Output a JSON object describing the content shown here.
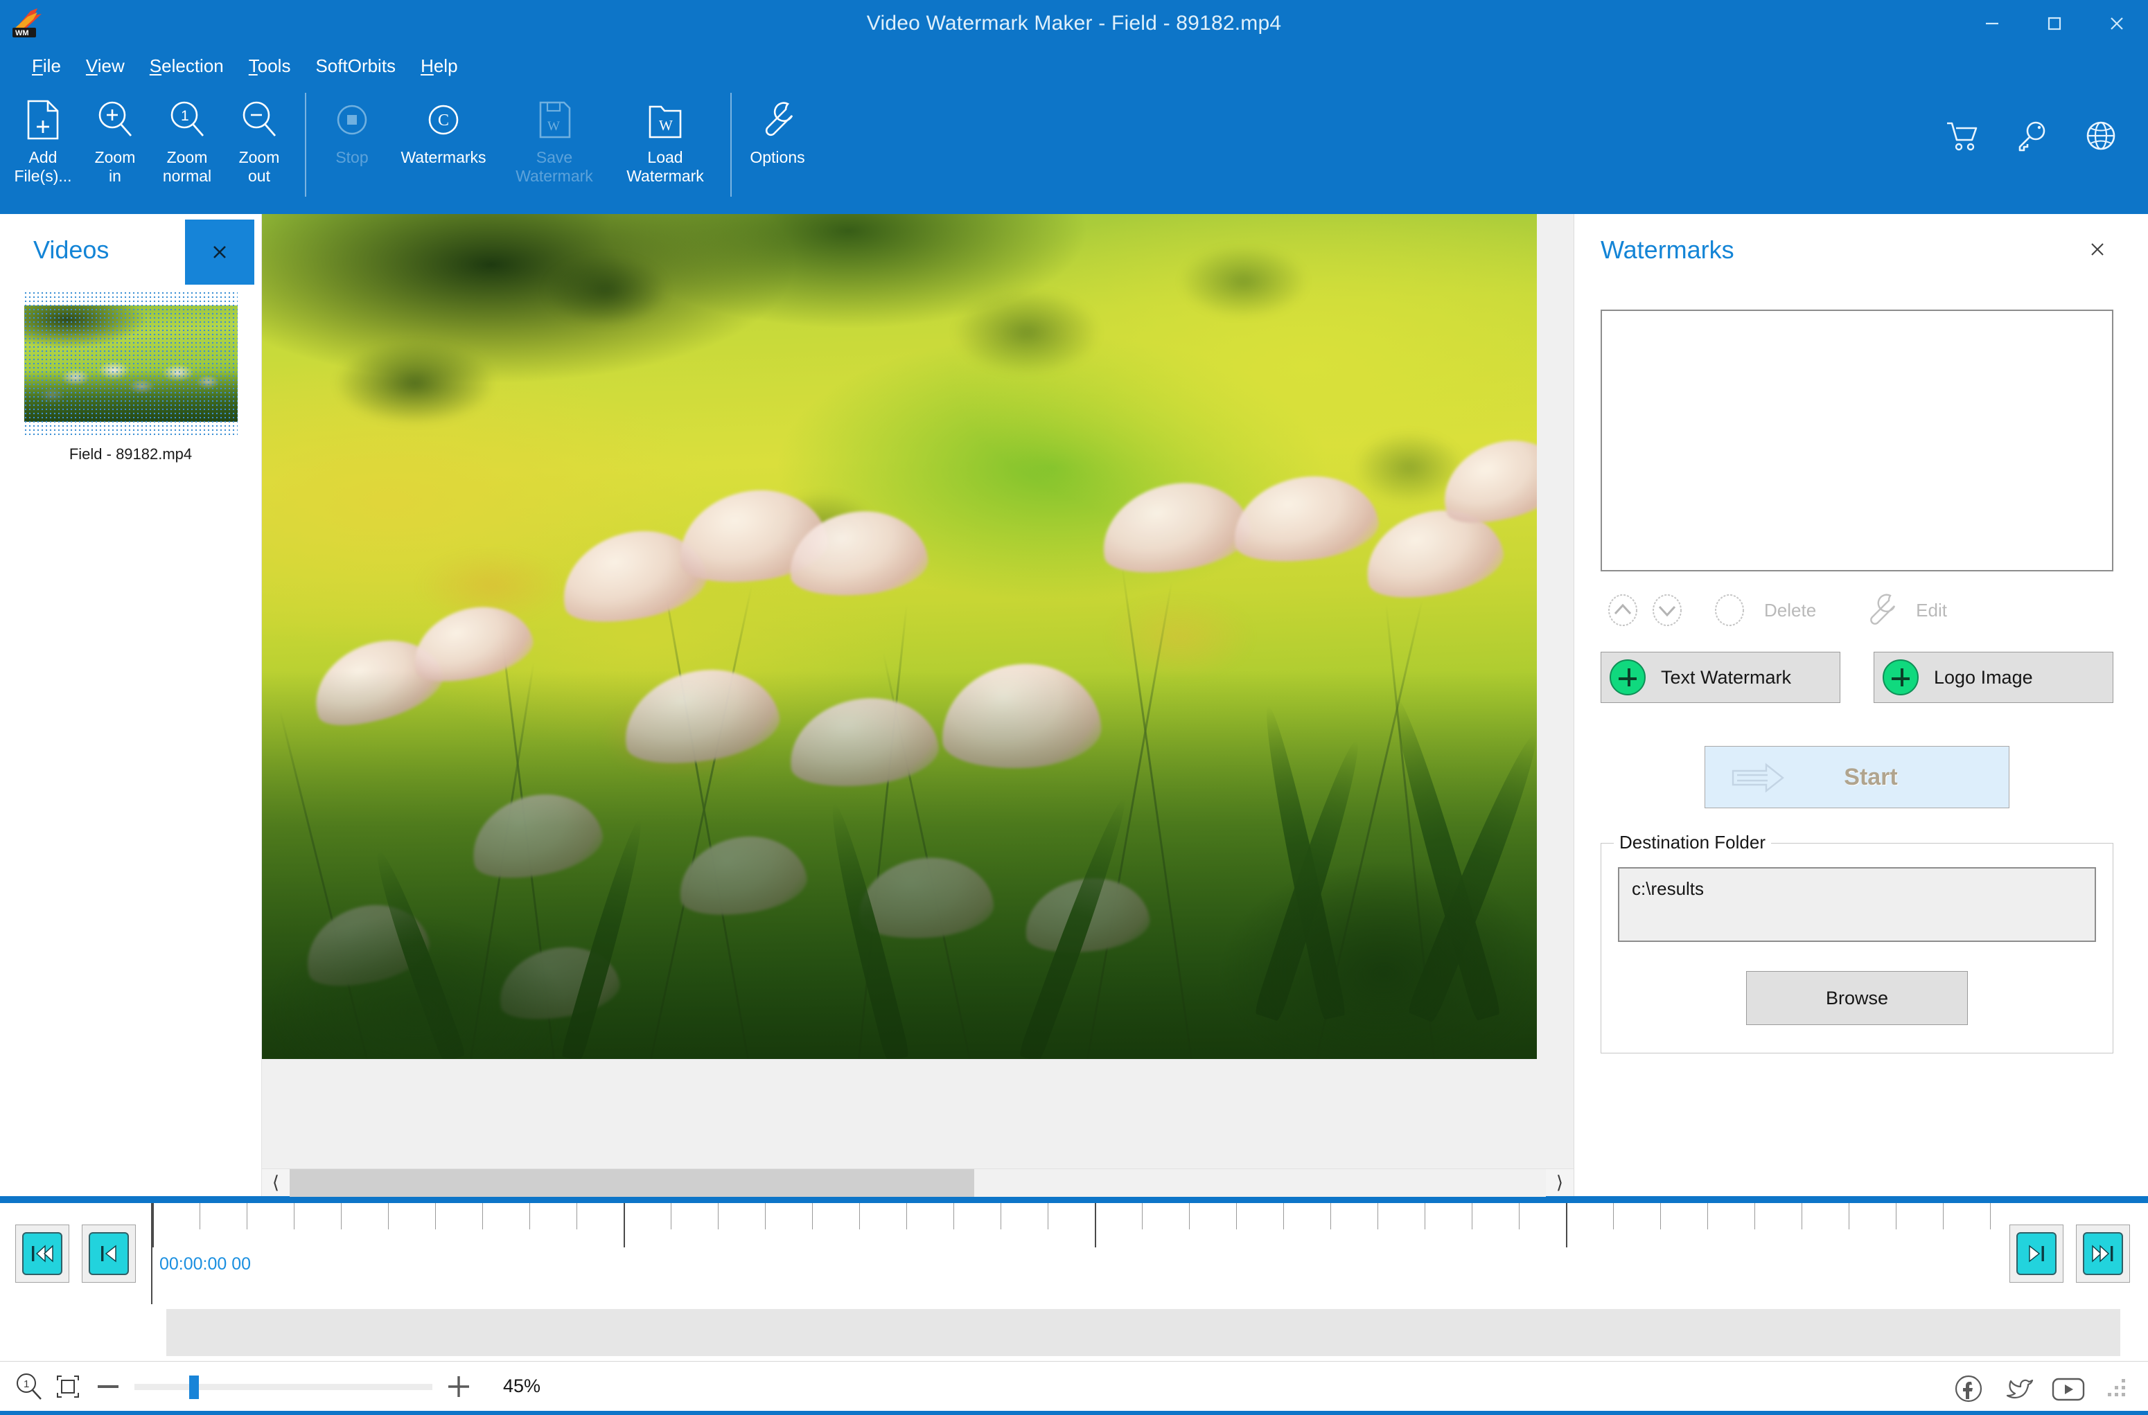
{
  "window": {
    "title": "Video Watermark Maker - Field - 89182.mp4",
    "logo_icon": "app-logo-icon",
    "minimize_icon": "minimize-icon",
    "maximize_icon": "maximize-icon",
    "close_icon": "close-icon"
  },
  "menubar": {
    "items": [
      {
        "label": "File",
        "accel": "F"
      },
      {
        "label": "View",
        "accel": "V"
      },
      {
        "label": "Selection",
        "accel": "S"
      },
      {
        "label": "Tools",
        "accel": "T"
      },
      {
        "label": "SoftOrbits",
        "accel": ""
      },
      {
        "label": "Help",
        "accel": "H"
      }
    ]
  },
  "toolbar": {
    "buttons": [
      {
        "label": "Add\nFile(s)...",
        "icon": "add-file-icon",
        "disabled": false
      },
      {
        "label": "Zoom\nin",
        "icon": "zoom-in-icon",
        "disabled": false
      },
      {
        "label": "Zoom\nnormal",
        "icon": "zoom-normal-icon",
        "disabled": false
      },
      {
        "label": "Zoom\nout",
        "icon": "zoom-out-icon",
        "disabled": false
      },
      {
        "label": "Stop",
        "icon": "stop-icon",
        "disabled": true
      },
      {
        "label": "Watermarks",
        "icon": "copyright-icon",
        "disabled": false
      },
      {
        "label": "Save\nWatermark",
        "icon": "save-watermark-icon",
        "disabled": true
      },
      {
        "label": "Load\nWatermark",
        "icon": "load-watermark-icon",
        "disabled": false
      },
      {
        "label": "Options",
        "icon": "wrench-icon",
        "disabled": false
      }
    ],
    "right_icons": [
      {
        "name": "cart-icon"
      },
      {
        "name": "key-icon"
      },
      {
        "name": "globe-icon"
      }
    ]
  },
  "videos_panel": {
    "title": "Videos",
    "close_icon": "close-icon",
    "items": [
      {
        "name": "Field - 89182.mp4",
        "selected": true
      }
    ]
  },
  "preview": {
    "scroll_left_icon": "chevron-left-icon",
    "scroll_right_icon": "chevron-right-icon",
    "scroll_thumb_percent": 54.5
  },
  "watermarks_panel": {
    "title": "Watermarks",
    "close_icon": "close-icon",
    "list_items": [],
    "actions": [
      {
        "label": "",
        "icon": "move-up-icon",
        "disabled": true
      },
      {
        "label": "",
        "icon": "move-down-icon",
        "disabled": true
      },
      {
        "label": "Delete",
        "icon": "delete-icon",
        "disabled": true
      },
      {
        "label": "Edit",
        "icon": "wrench-icon",
        "disabled": true
      }
    ],
    "add_buttons": [
      {
        "label": "Text Watermark",
        "icon": "plus-circle-icon"
      },
      {
        "label": "Logo Image",
        "icon": "plus-circle-icon"
      }
    ],
    "start_button": {
      "label": "Start",
      "icon": "arrow-right-icon",
      "disabled": true
    },
    "destination": {
      "legend": "Destination Folder",
      "path": "c:\\results",
      "browse_label": "Browse"
    }
  },
  "timeline": {
    "buttons_left": [
      {
        "name": "skip-to-start-button",
        "icon": "skip-start-icon"
      },
      {
        "name": "step-back-button",
        "icon": "step-back-icon"
      }
    ],
    "buttons_right": [
      {
        "name": "step-forward-button",
        "icon": "step-forward-icon"
      },
      {
        "name": "skip-to-end-button",
        "icon": "skip-end-icon"
      }
    ],
    "timecode": "00:00:00 00"
  },
  "statusbar": {
    "zoom_one_icon": "zoom-actual-icon",
    "fit_icon": "fit-to-window-icon",
    "minus_icon": "minus-icon",
    "plus_icon": "plus-icon",
    "zoom_percent": "45%",
    "slider_position_percent": 19,
    "social": [
      {
        "name": "facebook-icon"
      },
      {
        "name": "twitter-icon"
      },
      {
        "name": "youtube-icon"
      }
    ],
    "resize_grip_icon": "resize-grip-icon"
  },
  "colors": {
    "brand_blue": "#0d75c8",
    "title_blue": "#1384d6",
    "accent_cyan": "#22d3dd",
    "green_plus": "#10d97e",
    "timecode_blue": "#1a8fe0"
  }
}
